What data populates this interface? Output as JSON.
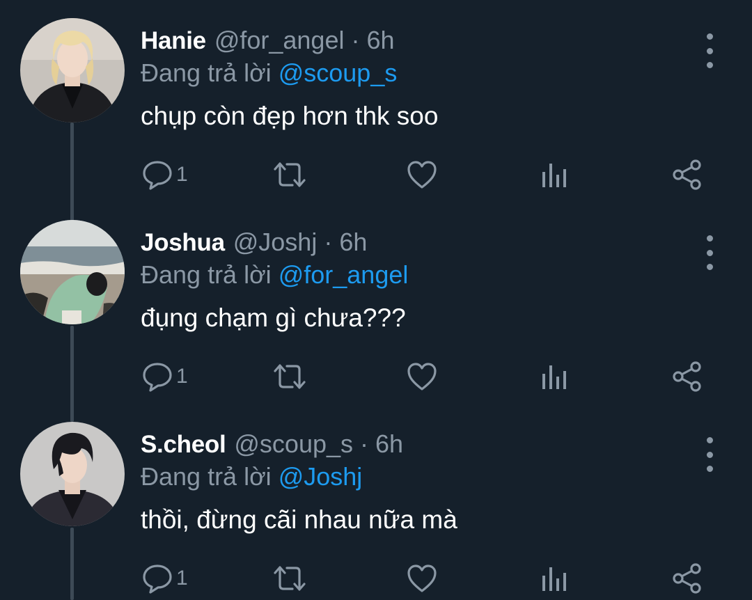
{
  "thread": {
    "tweets": [
      {
        "display_name": "Hanie",
        "handle": "@for_angel",
        "separator": "·",
        "time": "6h",
        "reply_prefix": "Đang trả lời",
        "reply_to": "@scoup_s",
        "text": "chụp còn đẹp hơn thk soo",
        "reply_count": "1",
        "avatar_icon": "avatar-blonde-person-icon"
      },
      {
        "display_name": "Joshua",
        "handle": "@Joshj",
        "separator": "·",
        "time": "6h",
        "reply_prefix": "Đang trả lời",
        "reply_to": "@for_angel",
        "text": "đụng chạm gì chưa???",
        "reply_count": "1",
        "avatar_icon": "avatar-beach-person-icon"
      },
      {
        "display_name": "S.cheol",
        "handle": "@scoup_s",
        "separator": "·",
        "time": "6h",
        "reply_prefix": "Đang trả lời",
        "reply_to": "@Joshj",
        "text": "thồi, đừng cãi nhau nữa mà",
        "reply_count": "1",
        "avatar_icon": "avatar-dark-hair-person-icon"
      }
    ]
  },
  "colors": {
    "background": "#15202b",
    "primary_text": "#ffffff",
    "secondary_text": "#8b98a5",
    "accent": "#1d9bf0",
    "thread_line": "#3d4a56"
  },
  "icons": [
    "reply-icon",
    "retweet-icon",
    "like-icon",
    "views-icon",
    "share-icon",
    "more-options-icon"
  ]
}
